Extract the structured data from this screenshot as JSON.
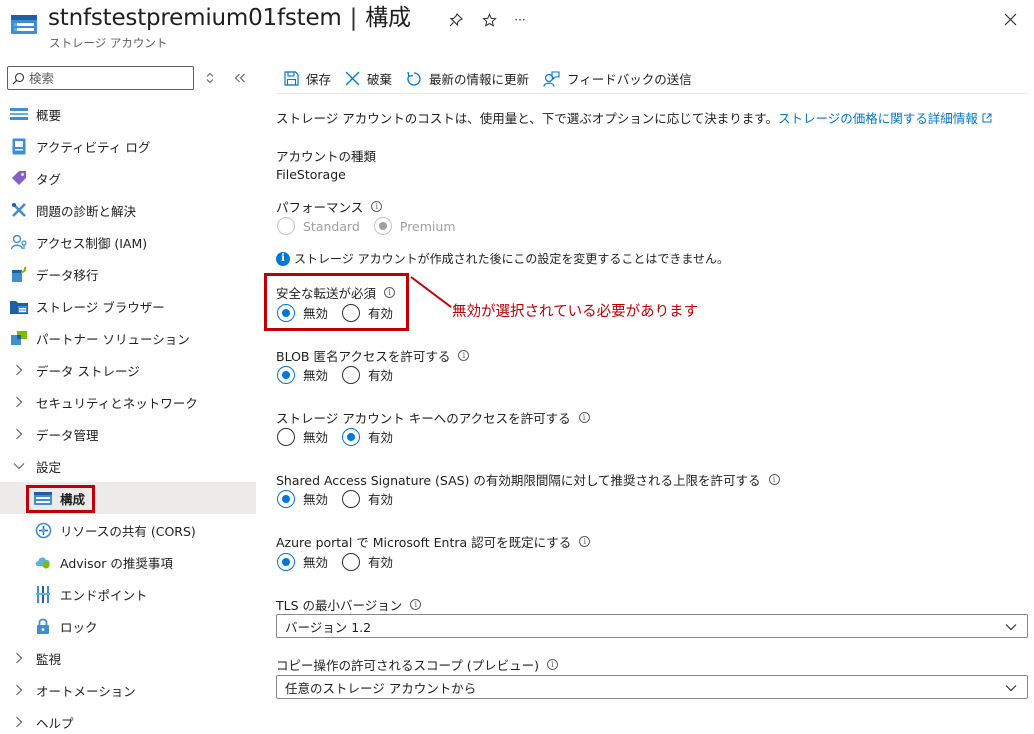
{
  "header": {
    "resource_name": "stnfstestpremium01fstem",
    "separator": "|",
    "blade_title": "構成",
    "resource_type": "ストレージ アカウント",
    "more_glyph": "···"
  },
  "sidebar": {
    "search_placeholder": "検索",
    "items": [
      {
        "label": "概要",
        "icon": "overview-icon",
        "type": "item"
      },
      {
        "label": "アクティビティ ログ",
        "icon": "activity-log-icon",
        "type": "item"
      },
      {
        "label": "タグ",
        "icon": "tag-icon",
        "type": "item"
      },
      {
        "label": "問題の診断と解決",
        "icon": "diagnose-icon",
        "type": "item"
      },
      {
        "label": "アクセス制御 (IAM)",
        "icon": "iam-icon",
        "type": "item"
      },
      {
        "label": "データ移行",
        "icon": "data-migration-icon",
        "type": "item"
      },
      {
        "label": "ストレージ ブラウザー",
        "icon": "storage-browser-icon",
        "type": "item"
      },
      {
        "label": "パートナー ソリューション",
        "icon": "partner-icon",
        "type": "item"
      },
      {
        "label": "データ ストレージ",
        "icon": "chevron-right-icon",
        "type": "group"
      },
      {
        "label": "セキュリティとネットワーク",
        "icon": "chevron-right-icon",
        "type": "group"
      },
      {
        "label": "データ管理",
        "icon": "chevron-right-icon",
        "type": "group"
      },
      {
        "label": "設定",
        "icon": "chevron-down-icon",
        "type": "group-open"
      },
      {
        "label": "構成",
        "icon": "configuration-icon",
        "type": "child",
        "selected": true
      },
      {
        "label": "リソースの共有 (CORS)",
        "icon": "cors-icon",
        "type": "child"
      },
      {
        "label": "Advisor の推奨事項",
        "icon": "advisor-icon",
        "type": "child"
      },
      {
        "label": "エンドポイント",
        "icon": "endpoint-icon",
        "type": "child"
      },
      {
        "label": "ロック",
        "icon": "lock-icon",
        "type": "child"
      },
      {
        "label": "監視",
        "icon": "chevron-right-icon",
        "type": "group"
      },
      {
        "label": "オートメーション",
        "icon": "chevron-right-icon",
        "type": "group"
      },
      {
        "label": "ヘルプ",
        "icon": "chevron-right-icon",
        "type": "group"
      }
    ]
  },
  "toolbar": {
    "save": "保存",
    "discard": "破棄",
    "refresh": "最新の情報に更新",
    "feedback": "フィードバックの送信"
  },
  "content": {
    "intro_text": "ストレージ アカウントのコストは、使用量と、下で選ぶオプションに応じて決まります。",
    "intro_link": "ストレージの価格に関する詳細情報",
    "account_kind_label": "アカウントの種類",
    "account_kind_value": "FileStorage",
    "performance_label": "パフォーマンス",
    "performance_options": [
      "Standard",
      "Premium"
    ],
    "performance_notice": "ストレージ アカウントが作成された後にこの設定を変更することはできません。",
    "secure_transfer_label": "安全な転送が必須",
    "annotation": "無効が選択されている必要があります",
    "blob_anon_label": "BLOB 匿名アクセスを許可する",
    "key_access_label": "ストレージ アカウント キーへのアクセスを許可する",
    "sas_label": "Shared Access Signature (SAS) の有効期限間隔に対して推奨される上限を許可する",
    "entra_label": "Azure portal で Microsoft Entra 認可を既定にする",
    "tls_label": "TLS の最小バージョン",
    "tls_value": "バージョン 1.2",
    "copy_scope_label": "コピー操作の許可されるスコープ (プレビュー)",
    "copy_scope_value": "任意のストレージ アカウントから",
    "off": "無効",
    "on": "有効",
    "info_glyph": "i"
  },
  "colors": {
    "accent": "#0078d4",
    "highlight": "#c00000"
  }
}
